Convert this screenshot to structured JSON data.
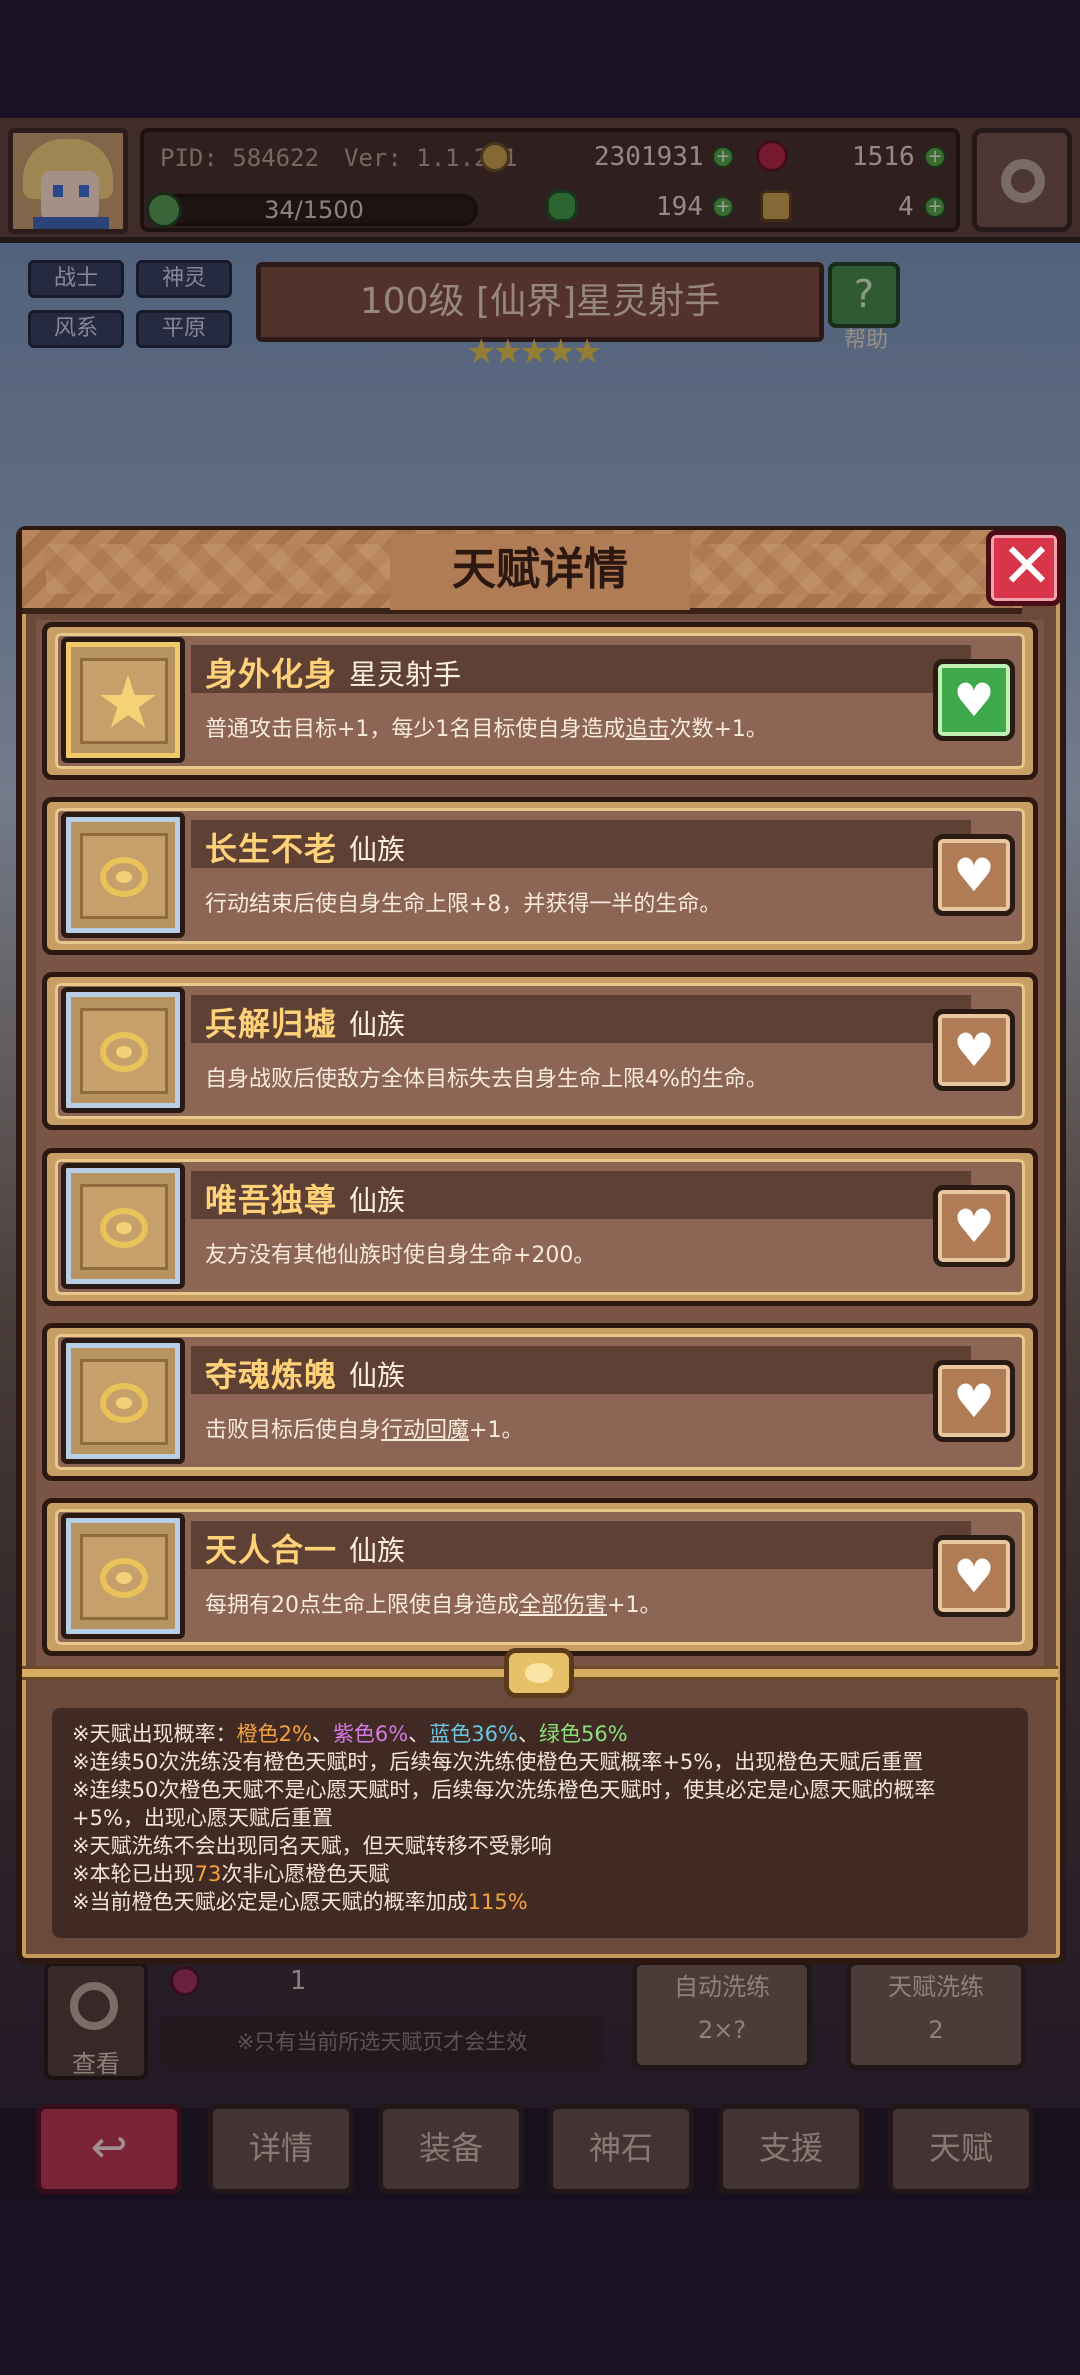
{
  "header": {
    "pid": "PID: 584622",
    "version": "Ver: 1.1.2.1",
    "gold": "2301931",
    "gems": "1516",
    "hp": "34/1500",
    "clover": "194",
    "keys": "4"
  },
  "hero": {
    "tags": [
      "战士",
      "神灵",
      "风系",
      "平原"
    ],
    "title": "100级 [仙界]星灵射手",
    "stars": "★★★★★",
    "help_label": "帮助",
    "help_glyph": "?"
  },
  "modal": {
    "title": "天赋详情",
    "close_glyph": "✕",
    "talents": [
      {
        "name": "身外化身",
        "tag": "星灵射手",
        "desc_parts": [
          "普通攻击目标+1，每少1名目标使自身造成",
          "追击",
          "次数+1。"
        ],
        "wish": true
      },
      {
        "name": "长生不老",
        "tag": "仙族",
        "desc_parts": [
          "行动结束后使自身生命上限+8，并获得一半的生命。",
          "",
          ""
        ],
        "wish": false
      },
      {
        "name": "兵解归墟",
        "tag": "仙族",
        "desc_parts": [
          "自身战败后使敌方全体目标失去自身生命上限4%的生命。",
          "",
          ""
        ],
        "wish": false
      },
      {
        "name": "唯吾独尊",
        "tag": "仙族",
        "desc_parts": [
          "友方没有其他仙族时使自身生命+200。",
          "",
          ""
        ],
        "wish": false
      },
      {
        "name": "夺魂炼魄",
        "tag": "仙族",
        "desc_parts": [
          "击败目标后使自身",
          "行动回魔",
          "+1。"
        ],
        "wish": false
      },
      {
        "name": "天人合一",
        "tag": "仙族",
        "desc_parts": [
          "每拥有20点生命上限使自身造成",
          "全部伤害",
          "+1。"
        ],
        "wish": false
      }
    ],
    "heart_glyph": "♥",
    "info": {
      "l1_prefix": "※天赋出现概率：",
      "orange": "橙色2%",
      "sep1": "、",
      "purple": "紫色6%",
      "sep2": "、",
      "blue": "蓝色36%",
      "sep3": "、",
      "green": "绿色56%",
      "l2": "※连续50次洗练没有橙色天赋时，后续每次洗练使橙色天赋概率+5%，出现橙色天赋后重置",
      "l3": "※连续50次橙色天赋不是心愿天赋时，后续每次洗练橙色天赋时，使其必定是心愿天赋的概率",
      "l4": "+5%，出现心愿天赋后重置",
      "l5": "※天赋洗练不会出现同名天赋，但天赋转移不受影响",
      "l6_prefix": "※本轮已出现",
      "l6_num": "73",
      "l6_suffix": "次非心愿橙色天赋",
      "l7_prefix": "※当前橙色天赋必定是心愿天赋的概率加成",
      "l7_num": "115%"
    }
  },
  "bottom": {
    "search_label": "查看",
    "bag_count": "1",
    "note": "※只有当前所选天赋页才会生效",
    "auto_wash_label": "自动洗练",
    "auto_wash_cost": "2×?",
    "talent_wash_label": "天赋洗练",
    "talent_wash_cost": "2"
  },
  "nav": {
    "back_glyph": "↩",
    "items": [
      "详情",
      "装备",
      "神石",
      "支援",
      "天赋"
    ]
  }
}
